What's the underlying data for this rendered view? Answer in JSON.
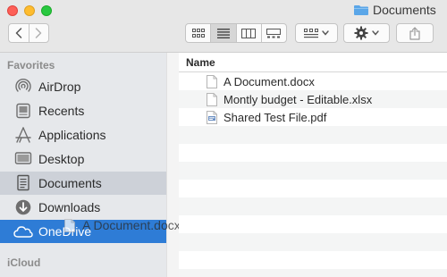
{
  "window": {
    "title": "Documents"
  },
  "toolbar": {
    "nav": [
      {
        "icon": "chevron-left-icon"
      },
      {
        "icon": "chevron-right-icon"
      }
    ],
    "views": [
      {
        "icon": "icon-view-icon",
        "active": false
      },
      {
        "icon": "list-view-icon",
        "active": true
      },
      {
        "icon": "column-view-icon",
        "active": false
      },
      {
        "icon": "gallery-view-icon",
        "active": false
      }
    ],
    "arrange_icon": "group-arrange-icon",
    "action_icon": "gear-icon",
    "share_icon": "share-icon"
  },
  "sidebar": {
    "favorites_heading": "Favorites",
    "items": [
      {
        "label": "AirDrop",
        "icon": "airdrop-icon"
      },
      {
        "label": "Recents",
        "icon": "recents-icon"
      },
      {
        "label": "Applications",
        "icon": "applications-icon"
      },
      {
        "label": "Desktop",
        "icon": "desktop-icon"
      },
      {
        "label": "Documents",
        "icon": "documents-icon",
        "selected": true
      },
      {
        "label": "Downloads",
        "icon": "downloads-icon"
      },
      {
        "label": "OneDrive",
        "icon": "cloud-icon",
        "drop_target": true
      }
    ],
    "icloud_heading": "iCloud"
  },
  "drag": {
    "label": "A Document.docx"
  },
  "file_list": {
    "column_header": "Name",
    "files": [
      {
        "name": "A Document.docx",
        "icon": "document-icon"
      },
      {
        "name": "Montly budget - Editable.xlsx",
        "icon": "document-icon"
      },
      {
        "name": "Shared Test File.pdf",
        "icon": "pdf-icon"
      }
    ]
  },
  "colors": {
    "selected_bg": "#cdd1d8",
    "drop_target_bg": "#2e7cd6",
    "folder_blue": "#5aa6e8"
  }
}
